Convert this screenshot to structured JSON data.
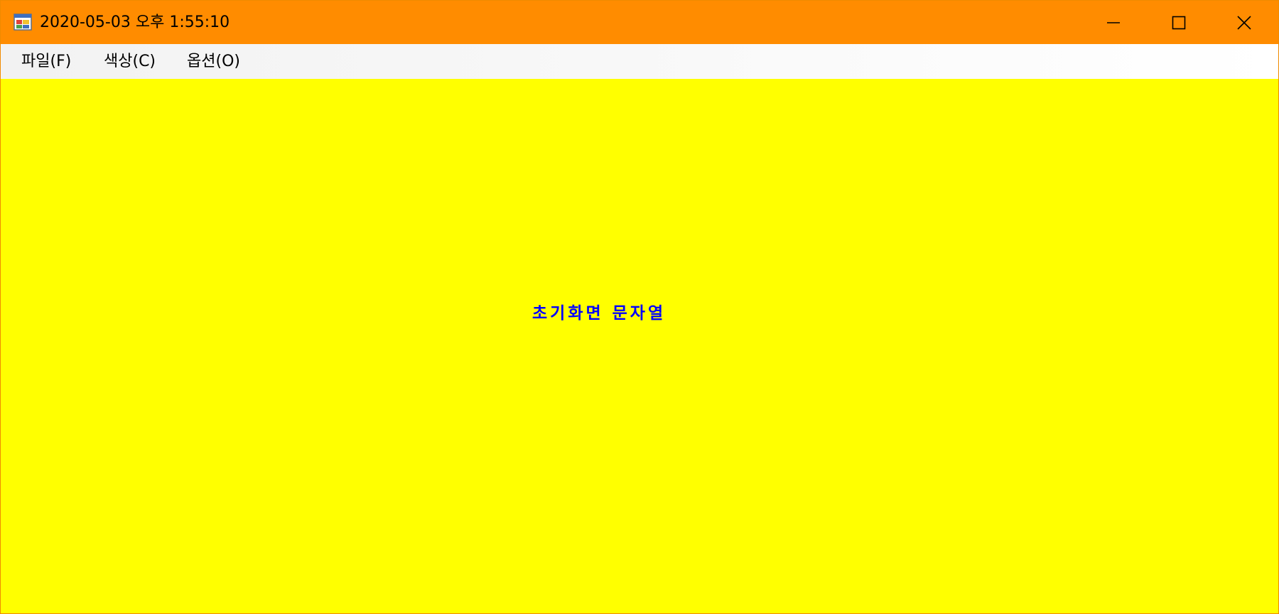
{
  "window": {
    "title": "2020-05-03 오후 1:55:10",
    "title_bar_color": "#ff8c00",
    "background_color": "#ffff00",
    "icons": {
      "app": "app-window-icon",
      "minimize": "minimize-icon",
      "maximize": "maximize-icon",
      "close": "close-icon"
    }
  },
  "menu": {
    "file": "파일(F)",
    "color": "색상(C)",
    "option": "옵션(O)"
  },
  "content": {
    "text": "초기화면 문자열",
    "text_color": "#0000ff"
  }
}
